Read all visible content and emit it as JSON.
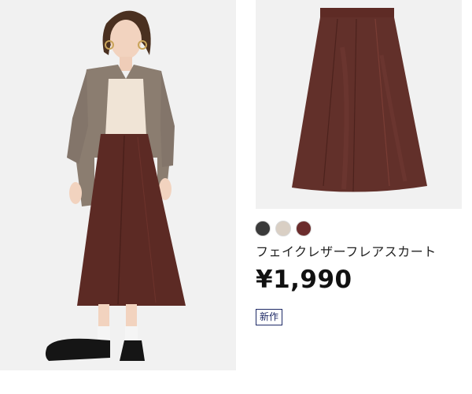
{
  "product": {
    "name": "フェイクレザーフレアスカート",
    "price": "¥1,990",
    "badge": "新作",
    "colors": [
      {
        "name": "black-swatch",
        "hex": "#3a3a3a"
      },
      {
        "name": "beige-swatch",
        "hex": "#d9cfc4"
      },
      {
        "name": "burgundy-swatch",
        "hex": "#6b2c2c"
      }
    ]
  },
  "palette": {
    "photo_bg": "#f1f1f1",
    "skirt": "#5c2a24",
    "shirt": "#8b7d70",
    "badge_accent": "#1e2a66"
  }
}
